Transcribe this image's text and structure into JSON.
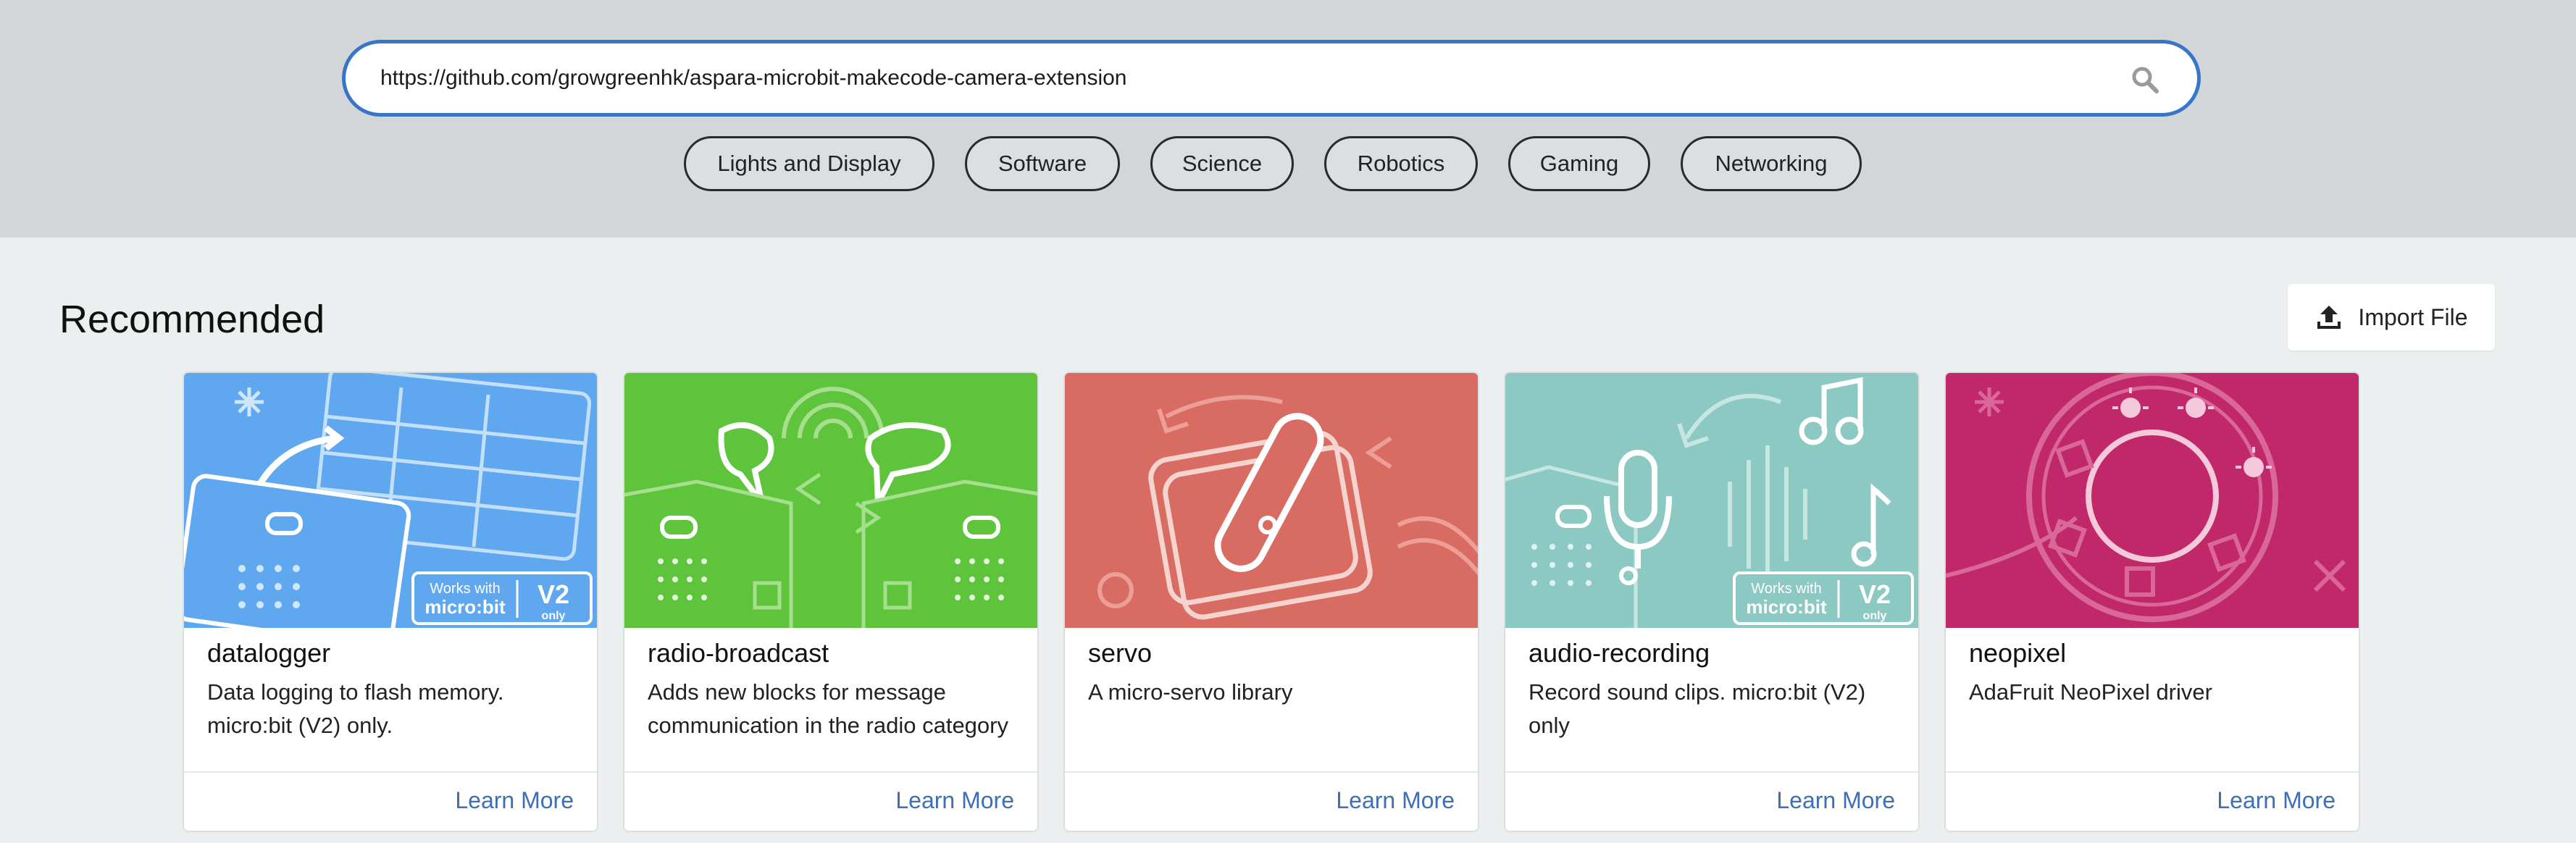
{
  "search": {
    "value": "https://github.com/growgreenhk/aspara-microbit-makecode-camera-extension",
    "icon": "search-icon"
  },
  "categories": [
    "Lights and Display",
    "Software",
    "Science",
    "Robotics",
    "Gaming",
    "Networking"
  ],
  "recommended": {
    "title": "Recommended",
    "import_label": "Import File"
  },
  "cards": [
    {
      "title": "datalogger",
      "description": "Data logging to flash memory. micro:bit (V2) only.",
      "link": "Learn More"
    },
    {
      "title": "radio-broadcast",
      "description": "Adds new blocks for message communication in the radio category",
      "link": "Learn More"
    },
    {
      "title": "servo",
      "description": "A micro-servo library",
      "link": "Learn More"
    },
    {
      "title": "audio-recording",
      "description": "Record sound clips. micro:bit (V2) only",
      "link": "Learn More"
    },
    {
      "title": "neopixel",
      "description": "AdaFruit NeoPixel driver",
      "link": "Learn More"
    }
  ],
  "badges": {
    "works_with": "Works with",
    "brand": "micro:bit",
    "version": "V2",
    "only": "only"
  },
  "colors": {
    "accent": "#3775c9",
    "datalogger": "#5fa8f0",
    "radio": "#5ec43c",
    "servo": "#d86b62",
    "audio": "#8cc9c2",
    "neopixel": "#c0286a",
    "link": "#3b6fb6"
  }
}
